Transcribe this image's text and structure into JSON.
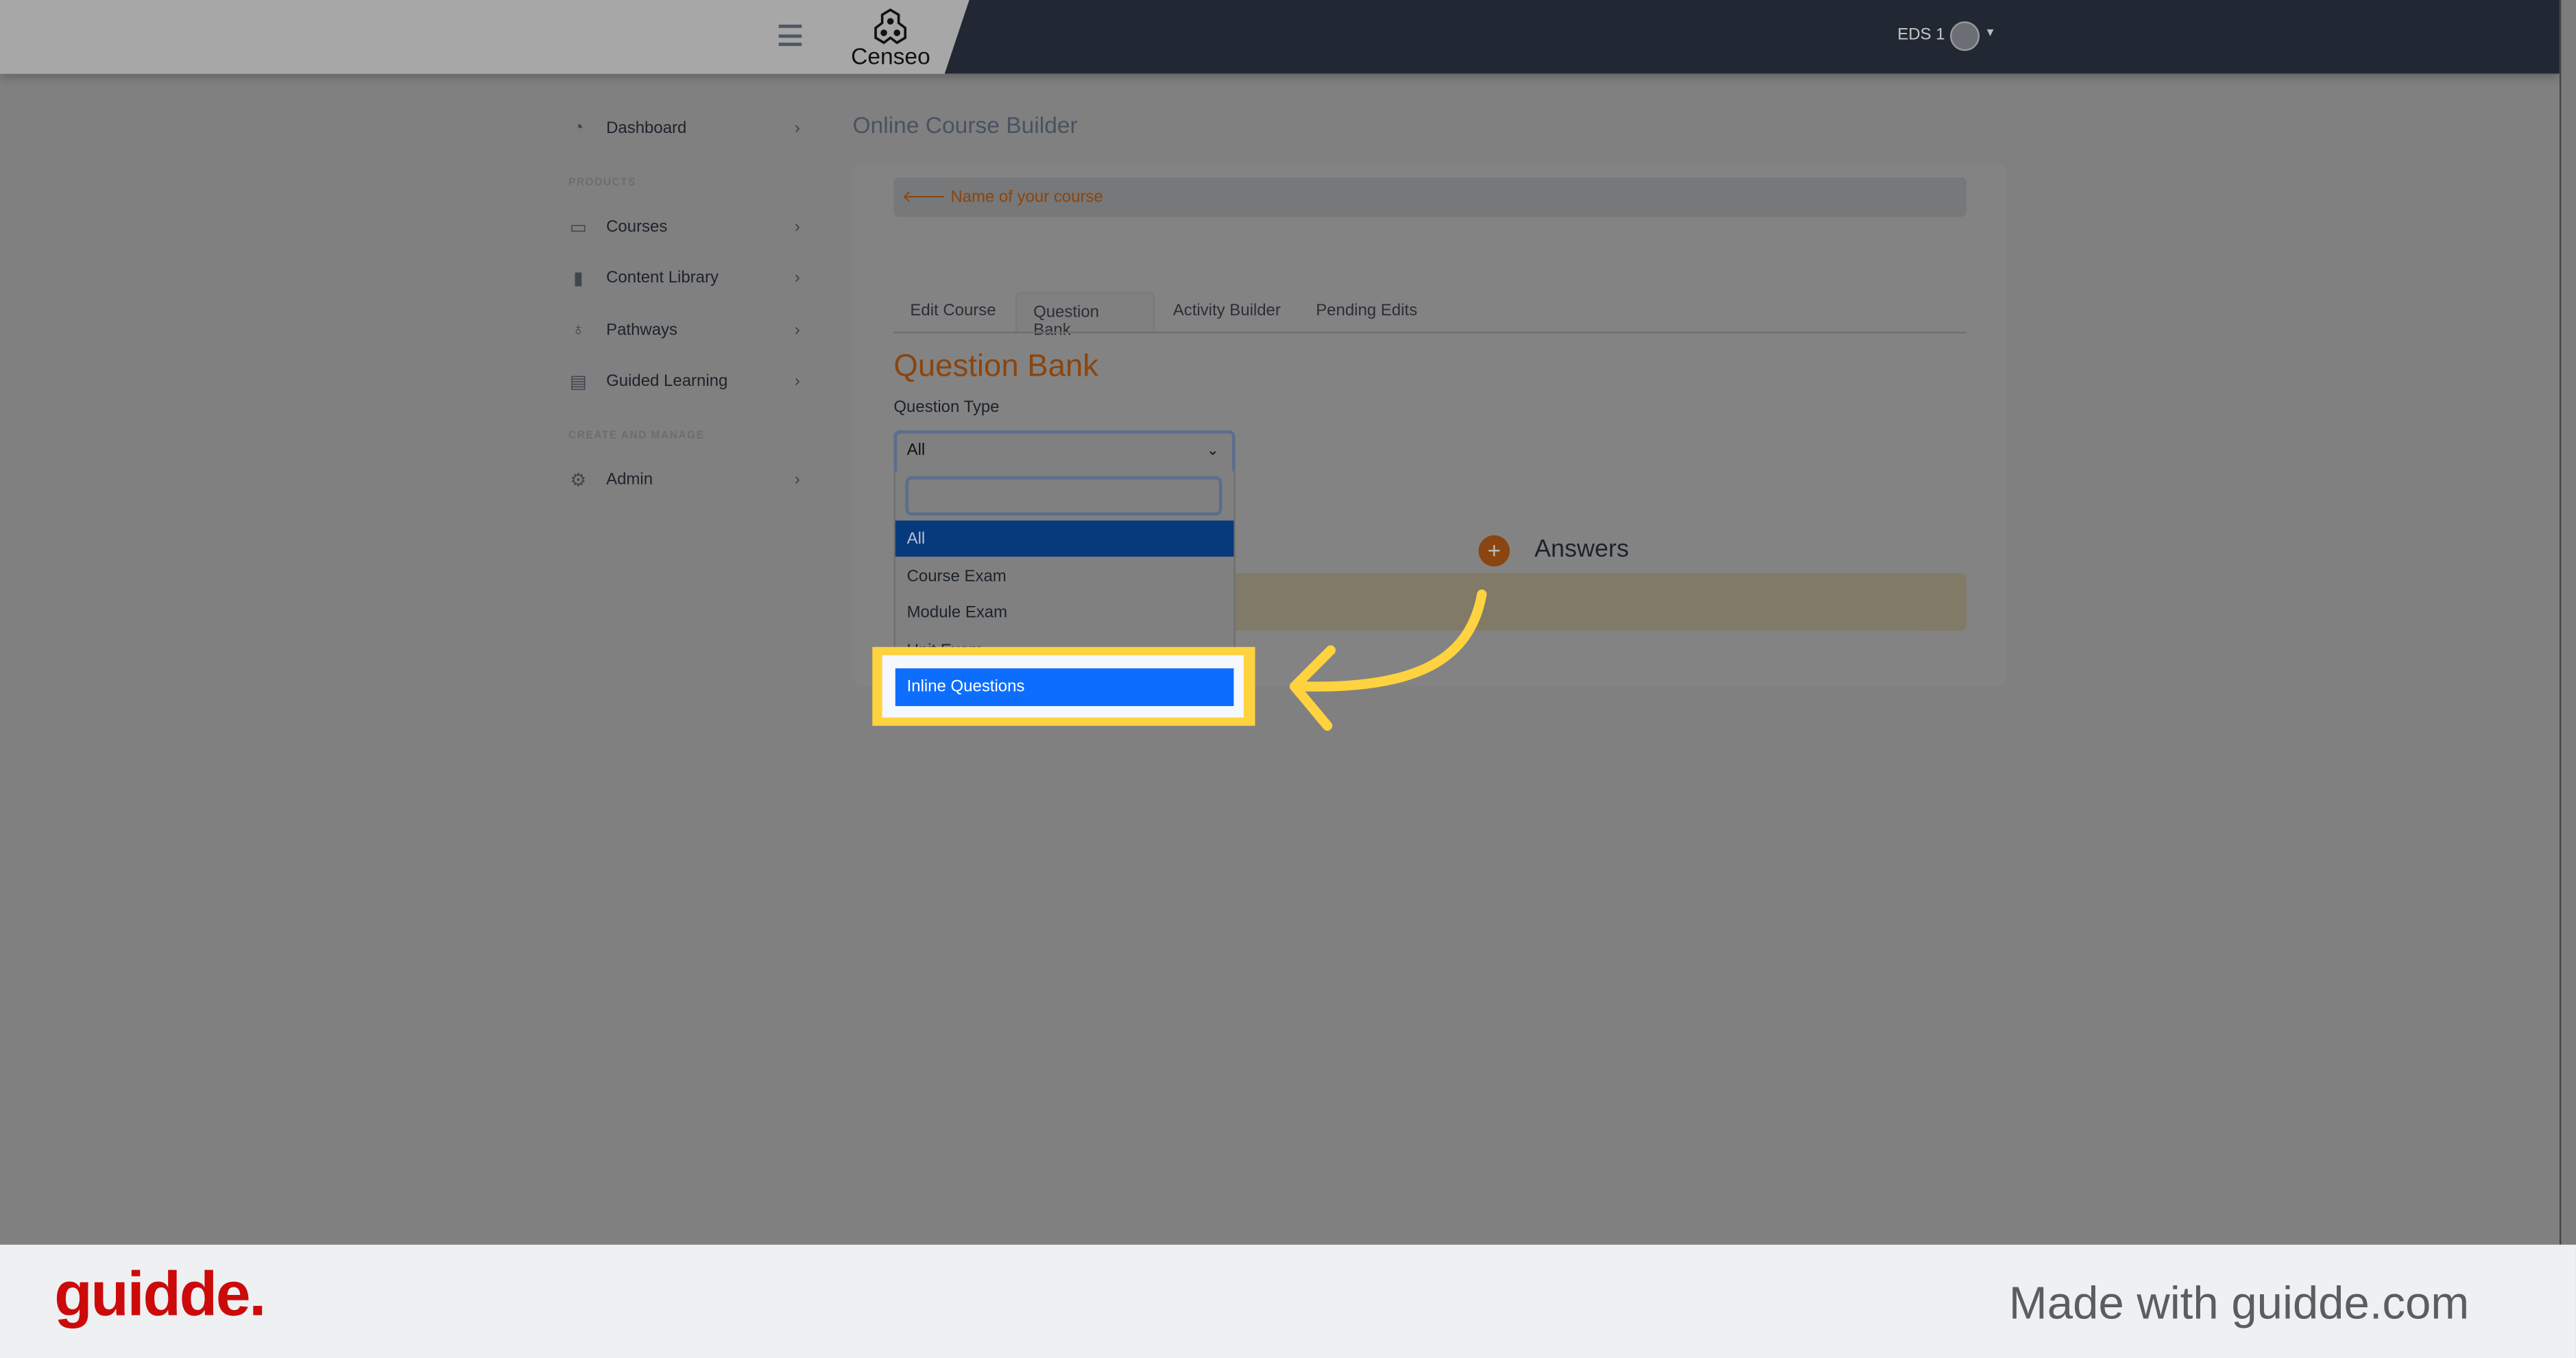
{
  "header": {
    "logo": "Censeo",
    "user": "EDS 1"
  },
  "sidebar": {
    "items": [
      {
        "label": "Dashboard",
        "icon": "gauge-icon"
      },
      {
        "label": "Courses",
        "icon": "chalkboard-icon"
      },
      {
        "label": "Content Library",
        "icon": "book-icon"
      },
      {
        "label": "Pathways",
        "icon": "award-icon"
      },
      {
        "label": "Guided Learning",
        "icon": "clipboard-icon"
      },
      {
        "label": "Admin",
        "icon": "gear-icon"
      }
    ],
    "sections": [
      "PRODUCTS",
      "CREATE AND MANAGE"
    ]
  },
  "main": {
    "page_title": "Online Course Builder",
    "back_link": "Name of your course",
    "tabs": [
      {
        "label": "Edit Course"
      },
      {
        "label": "Question Bank",
        "active": true
      },
      {
        "label": "Activity Builder"
      },
      {
        "label": "Pending Edits"
      }
    ],
    "heading": "Question Bank",
    "question_type_label": "Question Type",
    "select_value": "All",
    "search_value": "",
    "options": [
      "All",
      "Course Exam",
      "Module Exam",
      "Unit Exam",
      "Inline Questions"
    ],
    "answers_label": "Answers"
  },
  "colors": {
    "accent": "#c0651e",
    "highlight": "#ffd23f",
    "option_selected": "#0d6efd",
    "header": "#212833"
  },
  "footer": {
    "logo": "guidde.",
    "tagline": "Made with guidde.com"
  }
}
